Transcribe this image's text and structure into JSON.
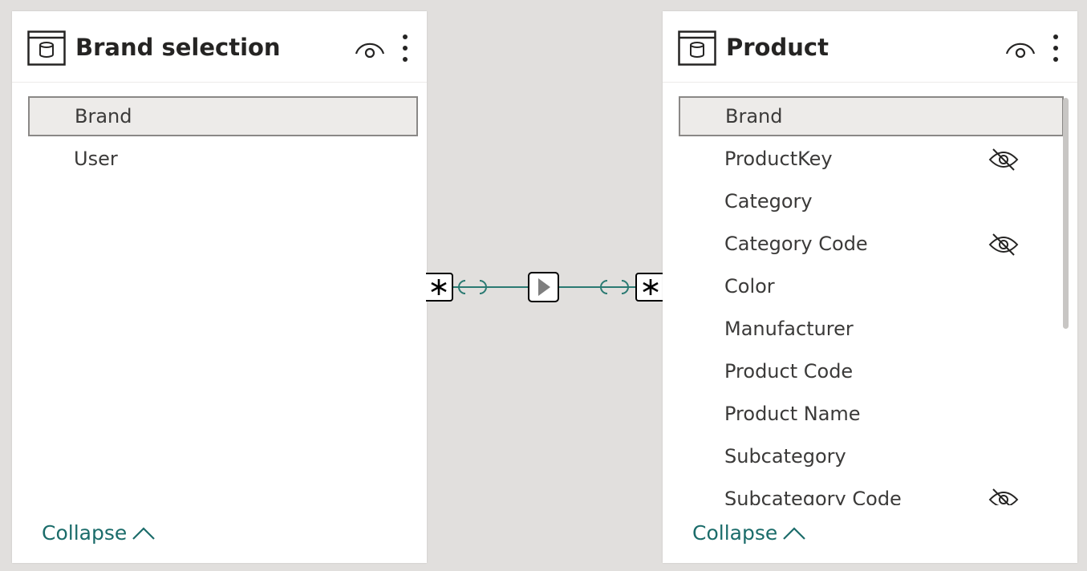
{
  "left_table": {
    "title": "Brand selection",
    "fields": [
      {
        "label": "Brand",
        "selected": true,
        "hidden": false
      },
      {
        "label": "User",
        "selected": false,
        "hidden": false
      }
    ],
    "collapse_label": "Collapse"
  },
  "right_table": {
    "title": "Product",
    "fields": [
      {
        "label": "Brand",
        "selected": true,
        "hidden": false
      },
      {
        "label": "ProductKey",
        "selected": false,
        "hidden": true
      },
      {
        "label": "Category",
        "selected": false,
        "hidden": false
      },
      {
        "label": "Category Code",
        "selected": false,
        "hidden": true
      },
      {
        "label": "Color",
        "selected": false,
        "hidden": false
      },
      {
        "label": "Manufacturer",
        "selected": false,
        "hidden": false
      },
      {
        "label": "Product Code",
        "selected": false,
        "hidden": false
      },
      {
        "label": "Product Name",
        "selected": false,
        "hidden": false
      },
      {
        "label": "Subcategory",
        "selected": false,
        "hidden": false
      },
      {
        "label": "Subcategory Code",
        "selected": false,
        "hidden": true
      }
    ],
    "collapse_label": "Collapse"
  },
  "relationship": {
    "left_cardinality": "*",
    "right_cardinality": "*",
    "cross_filter": "single-direction-arrow-icon"
  },
  "colors": {
    "canvas": "#e1dfdd",
    "card": "#ffffff",
    "accent": "#1b6c6a",
    "selected_row": "#edebe9",
    "relationship_line": "#2a7a72"
  }
}
